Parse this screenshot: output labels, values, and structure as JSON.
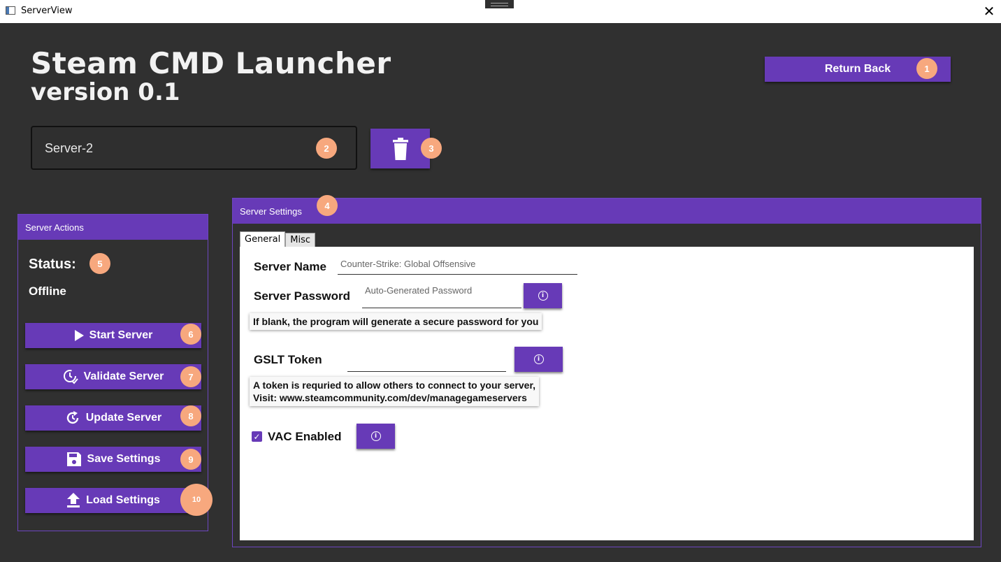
{
  "window": {
    "title": "ServerView",
    "close_glyph": "✕"
  },
  "header": {
    "title": "Steam CMD Launcher",
    "version": "version 0.1",
    "return_label": "Return Back"
  },
  "server": {
    "name": "Server-2"
  },
  "actions": {
    "panel_title": "Server Actions",
    "status_label": "Status:",
    "status_value": "Offline",
    "buttons": [
      {
        "label": "Start Server",
        "icon": "play-icon"
      },
      {
        "label": "Validate Server",
        "icon": "clock-check-icon"
      },
      {
        "label": "Update Server",
        "icon": "refresh-icon"
      },
      {
        "label": "Save Settings",
        "icon": "floppy-disk-icon"
      },
      {
        "label": "Load Settings",
        "icon": "upload-icon"
      }
    ]
  },
  "settings": {
    "panel_title": "Server Settings",
    "tabs": [
      "General",
      "Misc"
    ],
    "active_tab": "General",
    "server_name_label": "Server Name",
    "server_name_placeholder": "Counter-Strike: Global Offsensive",
    "password_label": "Server Password",
    "password_placeholder": "Auto-Generated Password",
    "password_tip": "If blank, the program will generate a secure password for you",
    "gslt_label": "GSLT Token",
    "gslt_value": "",
    "gslt_tip_line1": "A token is requried to allow others to connect to your server,",
    "gslt_tip_line2": "Visit: www.steamcommunity.com/dev/managegameservers",
    "vac_label": "VAC Enabled",
    "vac_checked": true,
    "info_glyph": "i"
  },
  "markers": [
    "1",
    "2",
    "3",
    "4",
    "5",
    "6",
    "7",
    "8",
    "9",
    "10"
  ],
  "colors": {
    "accent": "#673ab7",
    "background": "#303030",
    "marker": "#f7a87e"
  }
}
